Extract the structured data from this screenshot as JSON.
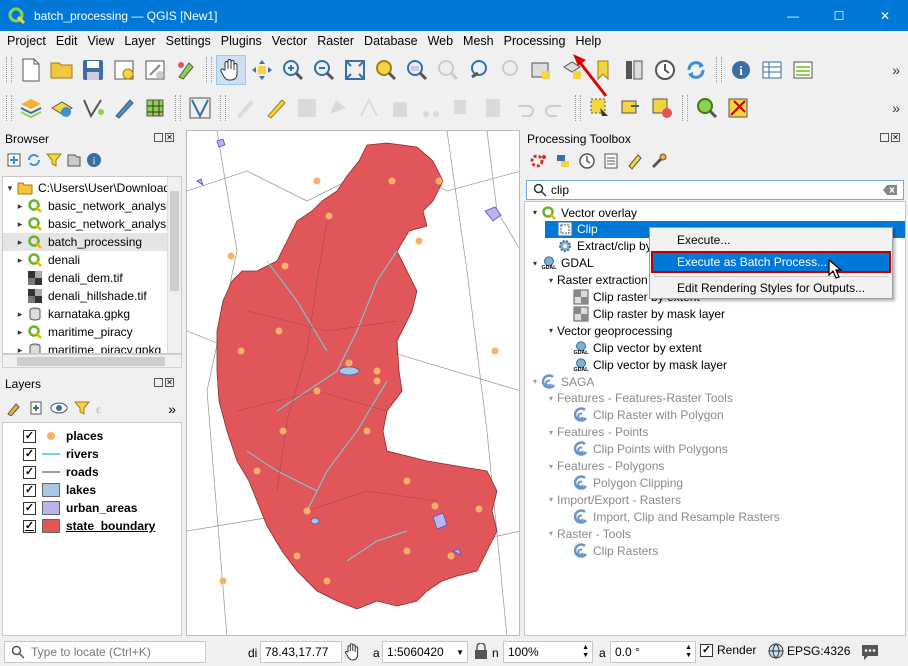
{
  "window": {
    "title": "batch_processing — QGIS [New1]",
    "controls": {
      "minimize": "—",
      "maximize": "☐",
      "close": "✕"
    }
  },
  "menubar": [
    "Project",
    "Edit",
    "View",
    "Layer",
    "Settings",
    "Plugins",
    "Vector",
    "Raster",
    "Database",
    "Web",
    "Mesh",
    "Processing",
    "Help"
  ],
  "toolbar_overflow": "»",
  "browser": {
    "title": "Browser",
    "items": [
      {
        "label": "C:\\Users\\User\\Downloads",
        "type": "folder",
        "expanded": true
      },
      {
        "label": "basic_network_analysis",
        "type": "qgis"
      },
      {
        "label": "basic_network_analysis",
        "type": "qgis"
      },
      {
        "label": "batch_processing",
        "type": "qgis"
      },
      {
        "label": "denali",
        "type": "qgis"
      },
      {
        "label": "denali_dem.tif",
        "type": "raster"
      },
      {
        "label": "denali_hillshade.tif",
        "type": "raster"
      },
      {
        "label": "karnataka.gpkg",
        "type": "gpkg"
      },
      {
        "label": "maritime_piracy",
        "type": "qgis"
      },
      {
        "label": "maritime_piracy.gpkg",
        "type": "gpkg"
      }
    ]
  },
  "layers": {
    "title": "Layers",
    "items": [
      {
        "label": "places",
        "checked": true,
        "symbol": "point",
        "color": "#f7b267"
      },
      {
        "label": "rivers",
        "checked": true,
        "symbol": "line",
        "color": "#72d6e0"
      },
      {
        "label": "roads",
        "checked": true,
        "symbol": "line",
        "color": "#9e9e9e"
      },
      {
        "label": "lakes",
        "checked": true,
        "symbol": "fill",
        "color": "#a7c7e7"
      },
      {
        "label": "urban_areas",
        "checked": true,
        "symbol": "fill",
        "color": "#b9b3ef"
      },
      {
        "label": "state_boundary",
        "checked": true,
        "symbol": "fill",
        "color": "#e15759"
      }
    ]
  },
  "processing": {
    "title": "Processing Toolbox",
    "search_value": "clip",
    "tree": [
      {
        "label": "Vector overlay",
        "level": 0,
        "arrow": "down",
        "icon": "qgis",
        "gray": false
      },
      {
        "label": "Clip",
        "level": 1,
        "arrow": "",
        "icon": "clip",
        "gray": false,
        "selected": true
      },
      {
        "label": "Extract/clip by extent",
        "level": 1,
        "arrow": "",
        "icon": "gear",
        "gray": false
      },
      {
        "label": "GDAL",
        "level": 0,
        "arrow": "down",
        "icon": "gdal",
        "gray": false
      },
      {
        "label": "Raster extraction",
        "level": 1,
        "arrow": "down",
        "icon": "",
        "gray": false
      },
      {
        "label": "Clip raster by extent",
        "level": 2,
        "arrow": "",
        "icon": "raster-tool",
        "gray": false
      },
      {
        "label": "Clip raster by mask layer",
        "level": 2,
        "arrow": "",
        "icon": "raster-tool",
        "gray": false
      },
      {
        "label": "Vector geoprocessing",
        "level": 1,
        "arrow": "down",
        "icon": "",
        "gray": false
      },
      {
        "label": "Clip vector by extent",
        "level": 2,
        "arrow": "",
        "icon": "gdal",
        "gray": false
      },
      {
        "label": "Clip vector by mask layer",
        "level": 2,
        "arrow": "",
        "icon": "gdal",
        "gray": false
      },
      {
        "label": "SAGA",
        "level": 0,
        "arrow": "down",
        "icon": "saga",
        "gray": true
      },
      {
        "label": "Features - Features-Raster Tools",
        "level": 1,
        "arrow": "down",
        "icon": "",
        "gray": true
      },
      {
        "label": "Clip Raster with Polygon",
        "level": 2,
        "arrow": "",
        "icon": "saga",
        "gray": true
      },
      {
        "label": "Features - Points",
        "level": 1,
        "arrow": "down",
        "icon": "",
        "gray": true
      },
      {
        "label": "Clip Points with Polygons",
        "level": 2,
        "arrow": "",
        "icon": "saga",
        "gray": true
      },
      {
        "label": "Features - Polygons",
        "level": 1,
        "arrow": "down",
        "icon": "",
        "gray": true
      },
      {
        "label": "Polygon Clipping",
        "level": 2,
        "arrow": "",
        "icon": "saga",
        "gray": true
      },
      {
        "label": "Import/Export - Rasters",
        "level": 1,
        "arrow": "down",
        "icon": "",
        "gray": true
      },
      {
        "label": "Import, Clip and Resample Rasters",
        "level": 2,
        "arrow": "",
        "icon": "saga",
        "gray": true
      },
      {
        "label": "Raster - Tools",
        "level": 1,
        "arrow": "down",
        "icon": "",
        "gray": true
      },
      {
        "label": "Clip Rasters",
        "level": 2,
        "arrow": "",
        "icon": "saga",
        "gray": true
      }
    ]
  },
  "context_menu": {
    "items": [
      "Execute...",
      "Execute as Batch Process...",
      "Edit Rendering Styles for Outputs..."
    ],
    "highlighted_index": 1
  },
  "statusbar": {
    "locate_placeholder": "Type to locate (Ctrl+K)",
    "coord_label": "di",
    "coordinate": "78.43,17.77",
    "scale_label": "a",
    "scale": "1:5060420",
    "magnifier_label": "n",
    "magnifier": "100%",
    "rotation_label": "a",
    "rotation": "0.0 °",
    "render_label": "Render",
    "render_checked": true,
    "crs": "EPSG:4326"
  },
  "colors": {
    "titlebar": "#0078d7",
    "selection": "#0078d7",
    "state_fill": "#e15759",
    "annotation_red": "#e00000"
  }
}
